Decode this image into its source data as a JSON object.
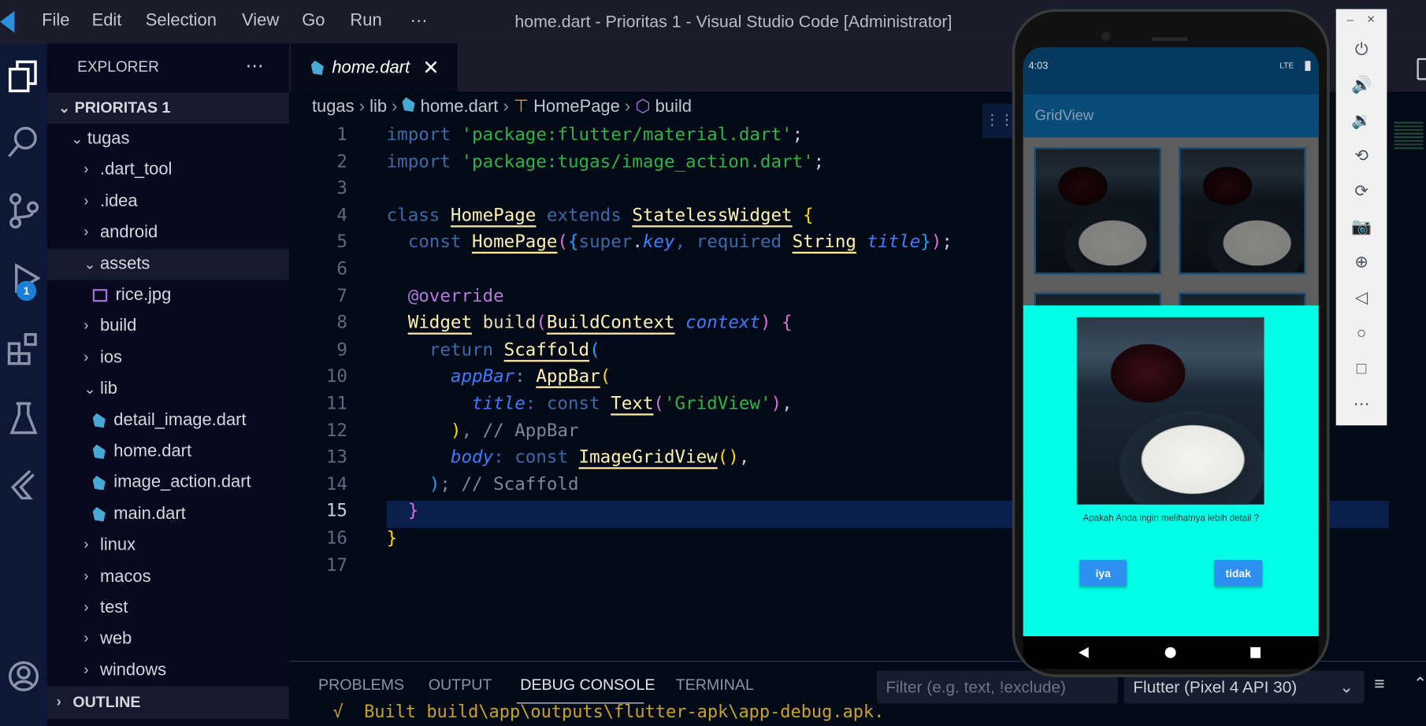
{
  "window": {
    "title": "home.dart - Prioritas 1 - Visual Studio Code [Administrator]"
  },
  "menu": [
    "File",
    "Edit",
    "Selection",
    "View",
    "Go",
    "Run",
    "⋯"
  ],
  "activity_bar": {
    "debug_badge": "1",
    "icons": [
      "explorer-icon",
      "search-icon",
      "source-control-icon",
      "run-debug-icon",
      "extensions-icon",
      "testing-icon",
      "flutter-icon",
      "account-icon"
    ]
  },
  "explorer": {
    "title": "EXPLORER",
    "more": "⋯",
    "root": "PRIORITAS 1",
    "items": [
      {
        "label": "tugas",
        "depth": 0,
        "kind": "open"
      },
      {
        "label": ".dart_tool",
        "depth": 1,
        "kind": "closed"
      },
      {
        "label": ".idea",
        "depth": 1,
        "kind": "closed"
      },
      {
        "label": "android",
        "depth": 1,
        "kind": "closed"
      },
      {
        "label": "assets",
        "depth": 1,
        "kind": "open",
        "selected": true
      },
      {
        "label": "rice.jpg",
        "depth": 2,
        "kind": "image"
      },
      {
        "label": "build",
        "depth": 1,
        "kind": "closed"
      },
      {
        "label": "ios",
        "depth": 1,
        "kind": "closed"
      },
      {
        "label": "lib",
        "depth": 1,
        "kind": "open"
      },
      {
        "label": "detail_image.dart",
        "depth": 2,
        "kind": "dart"
      },
      {
        "label": "home.dart",
        "depth": 2,
        "kind": "dart"
      },
      {
        "label": "image_action.dart",
        "depth": 2,
        "kind": "dart"
      },
      {
        "label": "main.dart",
        "depth": 2,
        "kind": "dart"
      },
      {
        "label": "linux",
        "depth": 1,
        "kind": "closed"
      },
      {
        "label": "macos",
        "depth": 1,
        "kind": "closed"
      },
      {
        "label": "test",
        "depth": 1,
        "kind": "closed"
      },
      {
        "label": "web",
        "depth": 1,
        "kind": "closed"
      },
      {
        "label": "windows",
        "depth": 1,
        "kind": "closed"
      }
    ],
    "outline": "OUTLINE"
  },
  "editor": {
    "tab": "home.dart",
    "breadcrumb": [
      "tugas",
      "lib",
      "home.dart",
      "HomePage",
      "build"
    ],
    "current_line": 15,
    "lines": [
      [
        {
          "t": "import ",
          "c": "kw"
        },
        {
          "t": "'package:flutter/material.dart'",
          "c": "str"
        },
        {
          "t": ";",
          "c": "pl"
        }
      ],
      [
        {
          "t": "import ",
          "c": "kw"
        },
        {
          "t": "'package:tugas/image_action.dart'",
          "c": "str"
        },
        {
          "t": ";",
          "c": "pl"
        }
      ],
      [],
      [
        {
          "t": "class ",
          "c": "kw"
        },
        {
          "t": "HomePage",
          "c": "cls"
        },
        {
          "t": " extends ",
          "c": "kw"
        },
        {
          "t": "StatelessWidget",
          "c": "cls"
        },
        {
          "t": " {",
          "c": "p1"
        }
      ],
      [
        {
          "t": "  const ",
          "c": "kw"
        },
        {
          "t": "HomePage",
          "c": "cls"
        },
        {
          "t": "(",
          "c": "p2"
        },
        {
          "t": "{",
          "c": "p3"
        },
        {
          "t": "super",
          "c": "kw"
        },
        {
          "t": ".",
          "c": "pl"
        },
        {
          "t": "key",
          "c": "prm"
        },
        {
          "t": ", required ",
          "c": "kw"
        },
        {
          "t": "String",
          "c": "cls"
        },
        {
          "t": " ",
          "c": "pl"
        },
        {
          "t": "title",
          "c": "prm"
        },
        {
          "t": "}",
          "c": "p3"
        },
        {
          "t": ")",
          "c": "p2"
        },
        {
          "t": ";",
          "c": "pl"
        }
      ],
      [],
      [
        {
          "t": "  @override",
          "c": "ann"
        }
      ],
      [
        {
          "t": "  ",
          "c": "pl"
        },
        {
          "t": "Widget",
          "c": "cls"
        },
        {
          "t": " build",
          "c": "fn"
        },
        {
          "t": "(",
          "c": "p2"
        },
        {
          "t": "BuildContext",
          "c": "cls"
        },
        {
          "t": " ",
          "c": "pl"
        },
        {
          "t": "context",
          "c": "prm"
        },
        {
          "t": ")",
          "c": "p2"
        },
        {
          "t": " {",
          "c": "p2"
        }
      ],
      [
        {
          "t": "    return ",
          "c": "kw"
        },
        {
          "t": "Scaffold",
          "c": "cls"
        },
        {
          "t": "(",
          "c": "p3"
        }
      ],
      [
        {
          "t": "      ",
          "c": "pl"
        },
        {
          "t": "appBar",
          "c": "prm"
        },
        {
          "t": ": ",
          "c": "pu"
        },
        {
          "t": "AppBar",
          "c": "cls"
        },
        {
          "t": "(",
          "c": "p1"
        }
      ],
      [
        {
          "t": "        ",
          "c": "pl"
        },
        {
          "t": "title",
          "c": "prm"
        },
        {
          "t": ": const ",
          "c": "kw"
        },
        {
          "t": "Text",
          "c": "cls"
        },
        {
          "t": "(",
          "c": "p2"
        },
        {
          "t": "'GridView'",
          "c": "str"
        },
        {
          "t": ")",
          "c": "p2"
        },
        {
          "t": ",",
          "c": "pl"
        }
      ],
      [
        {
          "t": "      )",
          "c": "p1"
        },
        {
          "t": ", // AppBar",
          "c": "cm"
        }
      ],
      [
        {
          "t": "      ",
          "c": "pl"
        },
        {
          "t": "body",
          "c": "prm"
        },
        {
          "t": ": const ",
          "c": "kw"
        },
        {
          "t": "ImageGridView",
          "c": "cls"
        },
        {
          "t": "()",
          "c": "p1"
        },
        {
          "t": ",",
          "c": "pl"
        }
      ],
      [
        {
          "t": "    )",
          "c": "p3"
        },
        {
          "t": "; // Scaffold",
          "c": "cm"
        }
      ],
      [
        {
          "t": "  }",
          "c": "p2"
        }
      ],
      [
        {
          "t": "}",
          "c": "p1"
        }
      ],
      []
    ]
  },
  "panel": {
    "tabs": [
      "PROBLEMS",
      "OUTPUT",
      "DEBUG CONSOLE",
      "TERMINAL"
    ],
    "active_tab": "DEBUG CONSOLE",
    "filter_placeholder": "Filter (e.g. text, !exclude)",
    "device_select": "Flutter (Pixel 4 API 30)",
    "console_line": "√  Built build\\app\\outputs\\flutter-apk\\app-debug.apk."
  },
  "emulator": {
    "status_time": "4:03",
    "status_network": "LTE",
    "app_bar_title": "GridView",
    "dialog": {
      "question": "Apakah Anda ingin melihatnya lebih detail ?",
      "yes": "iya",
      "no": "tidak",
      "background": "#00ffe6"
    },
    "toolbar": {
      "minimize": "–",
      "close": "×",
      "icons": [
        "power-icon",
        "volume-up-icon",
        "volume-down-icon",
        "rotate-left-icon",
        "rotate-right-icon",
        "camera-icon",
        "zoom-icon",
        "back-icon",
        "home-icon",
        "overview-icon",
        "more-icon"
      ]
    }
  }
}
